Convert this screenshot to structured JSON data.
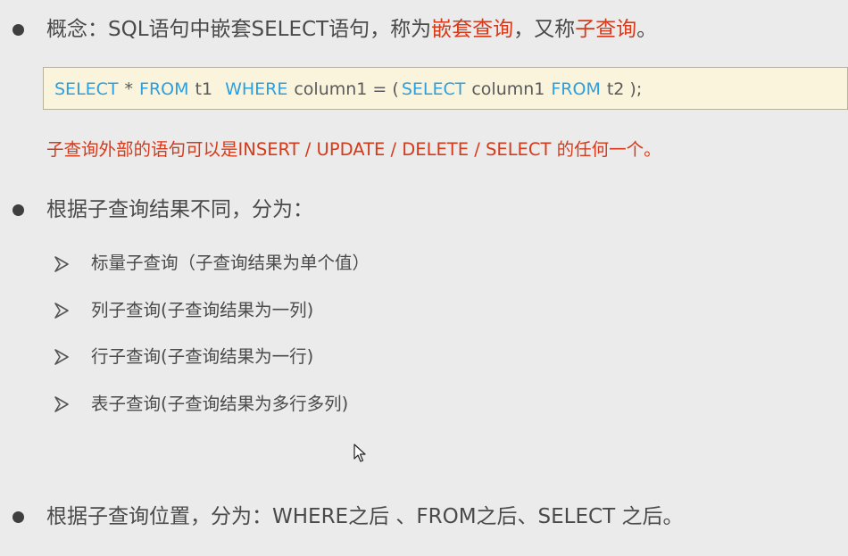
{
  "concept": {
    "prefix": "概念：SQL语句中嵌套SELECT语句，称为",
    "highlight1": "嵌套查询",
    "middle": "，又称",
    "highlight2": "子查询",
    "suffix": "。"
  },
  "code": {
    "tokens": [
      {
        "text": "SELECT",
        "kw": true
      },
      {
        "text": "*",
        "kw": false
      },
      {
        "text": "FROM",
        "kw": true
      },
      {
        "text": "t1",
        "kw": false
      },
      {
        "text": "WHERE",
        "kw": true
      },
      {
        "text": "column1 = (",
        "kw": false
      },
      {
        "text": "SELECT",
        "kw": true
      },
      {
        "text": "column1",
        "kw": false
      },
      {
        "text": "FROM",
        "kw": true
      },
      {
        "text": "t2 );",
        "kw": false
      }
    ]
  },
  "note": "子查询外部的语句可以是INSERT / UPDATE / DELETE / SELECT 的任何一个。",
  "by_result": {
    "heading": "根据子查询结果不同，分为：",
    "items": [
      "标量子查询（子查询结果为单个值）",
      "列子查询(子查询结果为一列)",
      "行子查询(子查询结果为一行)",
      "表子查询(子查询结果为多行多列)"
    ]
  },
  "by_position": {
    "heading": "根据子查询位置，分为：WHERE之后 、FROM之后、SELECT 之后。"
  },
  "colors": {
    "highlight": "#d63a1a",
    "keyword": "#2c9fe0",
    "code_background": "#fbf4dc"
  }
}
